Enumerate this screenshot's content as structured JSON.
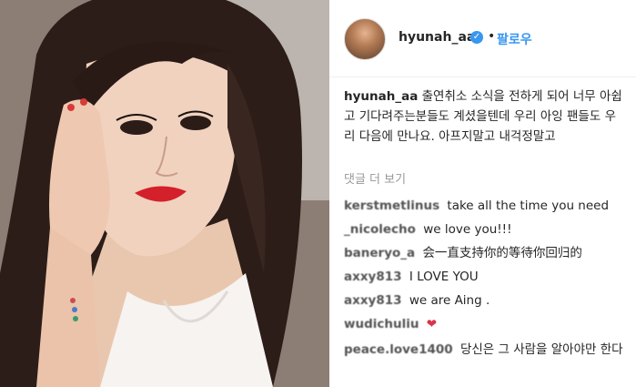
{
  "header": {
    "username": "hyunah_aa",
    "separator": "•",
    "follow_label": "팔로우"
  },
  "caption": {
    "username": "hyunah_aa",
    "text": "출연취소 소식을 전하게 되어 너무 아쉽고 기다려주는분들도 계셨을텐데 우리 아잉 팬들도 우리 다음에 만나요. 아프지말고 내걱정말고"
  },
  "view_more_label": "댓글 더 보기",
  "comments": [
    {
      "user": "kerstmetlinus",
      "text": "take all the time you need"
    },
    {
      "user": "_nicolecho",
      "text": "we love you!!!"
    },
    {
      "user": "baneryo_a",
      "text": "会一直支持你的等待你回归的"
    },
    {
      "user": "axxy813",
      "text": "I LOVE YOU"
    },
    {
      "user": "axxy813",
      "text": "we are Aing ."
    },
    {
      "user": "wudichuliu",
      "text": "❤"
    },
    {
      "user": "peace.love1400",
      "text": "당신은 그 사람을 알아야만 한다"
    }
  ],
  "colors": {
    "link": "#3897f0",
    "lipstick": "#d4202a",
    "heart": "#d9344a"
  }
}
